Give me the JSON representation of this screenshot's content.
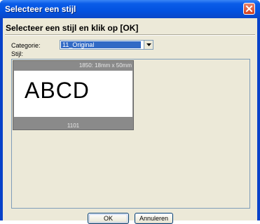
{
  "window": {
    "title": "Selecteer een stijl"
  },
  "dialog": {
    "heading": "Selecteer een stijl en klik op [OK]",
    "category_label": "Categorie:",
    "category_value": "11_Original",
    "style_label": "Stijl:"
  },
  "style_list": {
    "items": [
      {
        "size_label": "1850: 18mm x 50mm",
        "preview_text": "ABCD",
        "number": "1101"
      }
    ]
  },
  "buttons": {
    "ok_label": "OK",
    "cancel_label": "Annuleren"
  },
  "colors": {
    "title_bar": "#0a5ce8",
    "dialog_bg": "#ece9d8",
    "selection": "#316ac5",
    "close_button": "#d3401e"
  },
  "icons": {
    "close": "close-icon",
    "dropdown": "chevron-down-icon"
  }
}
